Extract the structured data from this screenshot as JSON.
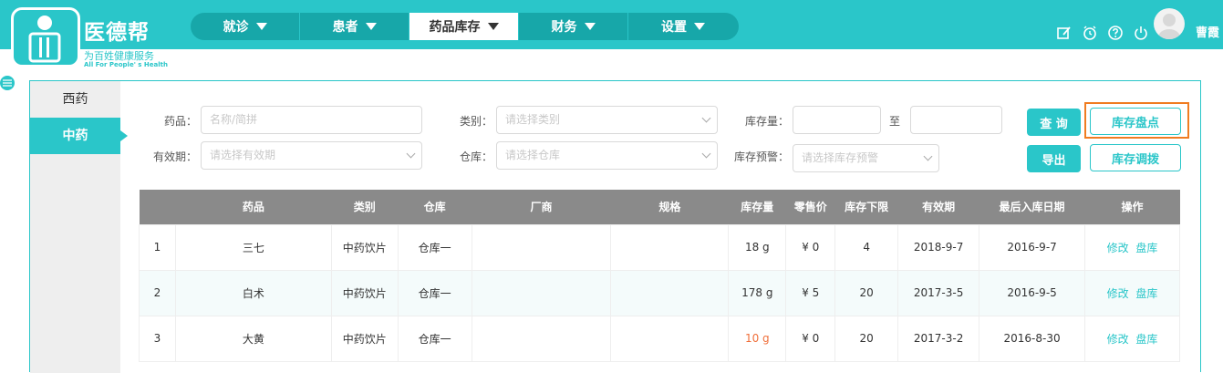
{
  "brand": {
    "title": "医德帮",
    "subtitle": "为百姓健康服务",
    "slogan": "All For People' s Health"
  },
  "nav": [
    {
      "label": "就诊",
      "active": false
    },
    {
      "label": "患者",
      "active": false
    },
    {
      "label": "药品库存",
      "active": true
    },
    {
      "label": "财务",
      "active": false
    },
    {
      "label": "设置",
      "active": false
    }
  ],
  "user": {
    "name": "曹霞"
  },
  "sidebar": {
    "items": [
      {
        "label": "西药",
        "active": false
      },
      {
        "label": "中药",
        "active": true
      }
    ]
  },
  "filters": {
    "drug_label": "药品：",
    "drug_placeholder": "名称/简拼",
    "category_label": "类别：",
    "category_placeholder": "请选择类别",
    "stock_label": "库存量：",
    "stock_to": "至",
    "expiry_label": "有效期：",
    "expiry_placeholder": "请选择有效期",
    "warehouse_label": "仓库：",
    "warehouse_placeholder": "请选择仓库",
    "alert_label": "库存预警：",
    "alert_placeholder": "请选择库存预警"
  },
  "buttons": {
    "query": "查 询",
    "inventory_check": "库存盘点",
    "export": "导出",
    "transfer": "库存调拨"
  },
  "table": {
    "headers": [
      "",
      "药品",
      "类别",
      "仓库",
      "厂商",
      "规格",
      "库存量",
      "零售价",
      "库存下限",
      "有效期",
      "最后入库日期",
      "操作"
    ],
    "rows": [
      {
        "no": "1",
        "drug": "三七",
        "category": "中药饮片",
        "warehouse": "仓库一",
        "maker": "",
        "spec": "",
        "stock": "18 g",
        "price": "¥ 0",
        "min": "4",
        "expiry": "2018-9-7",
        "last_in": "2016-9-7",
        "edit": "修改",
        "check": "盘库",
        "warn": false
      },
      {
        "no": "2",
        "drug": "白术",
        "category": "中药饮片",
        "warehouse": "仓库一",
        "maker": "",
        "spec": "",
        "stock": "178 g",
        "price": "¥ 5",
        "min": "20",
        "expiry": "2017-3-5",
        "last_in": "2016-9-5",
        "edit": "修改",
        "check": "盘库",
        "warn": false
      },
      {
        "no": "3",
        "drug": "大黄",
        "category": "中药饮片",
        "warehouse": "仓库一",
        "maker": "",
        "spec": "",
        "stock": "10 g",
        "price": "¥ 0",
        "min": "20",
        "expiry": "2017-3-2",
        "last_in": "2016-8-30",
        "edit": "修改",
        "check": "盘库",
        "warn": true
      }
    ]
  },
  "colors": {
    "accent": "#2ac6c9",
    "header_gray": "#8a8a8a",
    "warning": "#f06f3a",
    "highlight": "#f07c21"
  }
}
